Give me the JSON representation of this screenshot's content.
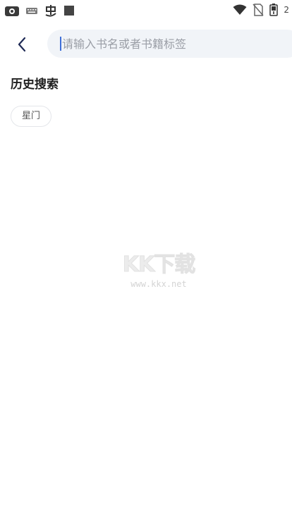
{
  "status_bar": {
    "clock": "2",
    "icons_left": [
      "app-icon",
      "keyboard-icon",
      "bug-icon",
      "square-icon"
    ],
    "icons_right": [
      "wifi-icon",
      "no-sim-icon",
      "battery-icon"
    ]
  },
  "search": {
    "placeholder": "请输入书名或者书籍标签",
    "value": ""
  },
  "history": {
    "title": "历史搜索",
    "items": [
      "星门"
    ]
  },
  "watermark": {
    "main": "KK下载",
    "url": "www.kkx.net"
  },
  "colors": {
    "accent": "#3f6fd8",
    "search_bg": "#f1f4f8",
    "chip_border": "#e4e6ea"
  }
}
